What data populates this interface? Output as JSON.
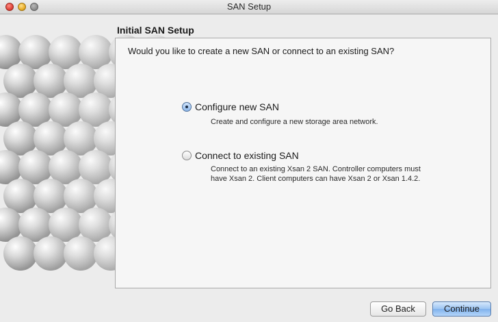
{
  "window": {
    "title": "SAN Setup"
  },
  "section": {
    "title": "Initial SAN Setup"
  },
  "question": "Would you like to create a new SAN or connect to an existing SAN?",
  "options": [
    {
      "label": "Configure new SAN",
      "description": "Create and configure a new storage area network.",
      "selected": true
    },
    {
      "label": "Connect to existing SAN",
      "description": "Connect to an existing Xsan 2 SAN. Controller computers must have Xsan 2. Client computers can have Xsan 2 or Xsan 1.4.2.",
      "selected": false
    }
  ],
  "buttons": {
    "back": "Go Back",
    "continue": "Continue"
  },
  "icons": {
    "close": "close-icon",
    "minimize": "minimize-icon",
    "zoom": "zoom-icon",
    "art": "sphere-cluster-image"
  },
  "colors": {
    "accent": "#7fb1ec",
    "window_bg": "#ececec",
    "panel_bg": "#f6f6f6"
  }
}
